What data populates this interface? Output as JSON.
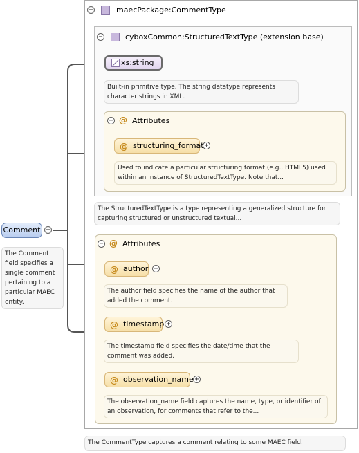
{
  "comment_element": {
    "name": "Comment",
    "doc": "The Comment field specifies a single comment pertaining to a particular MAEC entity."
  },
  "comment_type": {
    "title": "maecPackage:CommentType",
    "doc": "The CommentType captures a comment relating to some MAEC field."
  },
  "structured_text": {
    "title": "cyboxCommon:StructuredTextType (extension base)",
    "doc": "The StructuredTextType is a type representing a generalized structure for capturing structured or unstructured textual...",
    "base": {
      "name": "xs:string",
      "doc": "Built-in primitive type. The string datatype represents character strings in XML."
    },
    "attributes_label": "Attributes",
    "attributes": [
      {
        "name": "structuring_format",
        "doc": "Used to indicate a particular structuring format (e.g., HTML5) used within an instance of StructuredTextType. Note that..."
      }
    ]
  },
  "comment_attributes": {
    "label": "Attributes",
    "items": [
      {
        "name": "author",
        "doc": "The author field specifies the name of the author that added the comment."
      },
      {
        "name": "timestamp",
        "doc": "The timestamp field specifies the date/time that the comment was added."
      },
      {
        "name": "observation_name",
        "doc": "The observation_name field captures the name, type, or identifier of an observation, for comments that refer to the..."
      }
    ]
  },
  "symbols": {
    "collapse": "⊖",
    "expand": "+",
    "attribute": "@"
  }
}
